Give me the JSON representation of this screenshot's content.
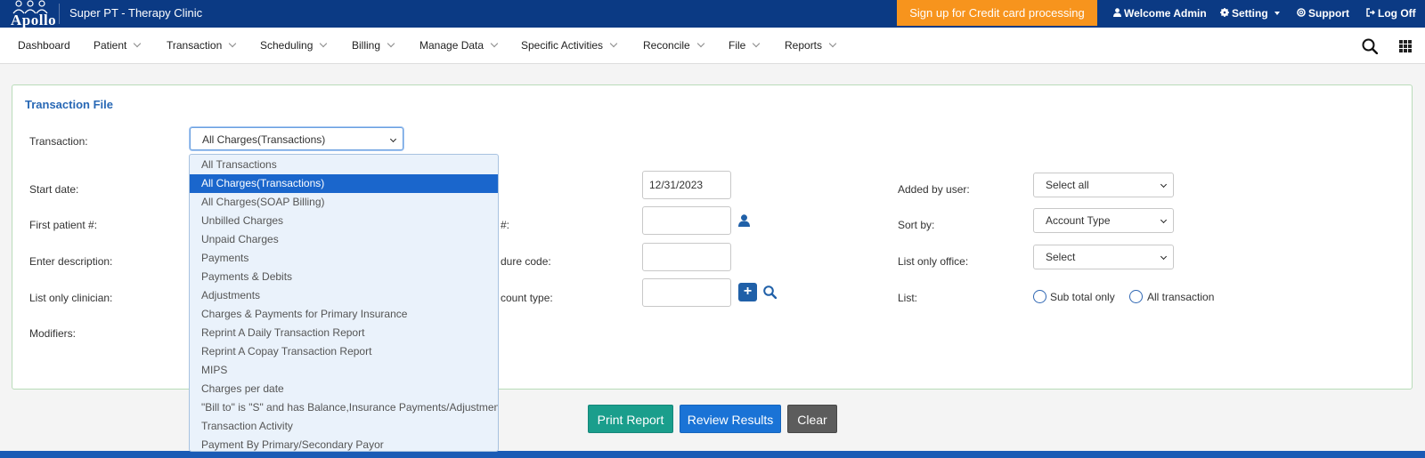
{
  "header": {
    "logo_text": "Apollo",
    "clinic_name": "Super PT - Therapy Clinic",
    "signup_label": "Sign up for Credit card processing",
    "welcome_label": "Welcome Admin",
    "setting_label": "Setting",
    "support_label": "Support",
    "logoff_label": "Log Off"
  },
  "nav": {
    "items": [
      "Dashboard",
      "Patient",
      "Transaction",
      "Scheduling",
      "Billing",
      "Manage Data",
      "Specific Activities",
      "Reconcile",
      "File",
      "Reports"
    ]
  },
  "form": {
    "title": "Transaction File",
    "transaction_label": "Transaction:",
    "transaction_value": "All Charges(Transactions)",
    "start_date_label": "Start date:",
    "end_date_value": "12/31/2023",
    "first_patient_label": "First patient #:",
    "last_patient_label_partial": "#:",
    "enter_description_label": "Enter description:",
    "procedure_code_label_partial": "dure code:",
    "list_only_clinician_label": "List only clinician:",
    "account_type_label_partial": "count type:",
    "modifiers_label": "Modifiers:",
    "added_by_user_label": "Added by user:",
    "added_by_user_value": "Select all",
    "sort_by_label": "Sort by:",
    "sort_by_value": "Account Type",
    "list_only_office_label": "List only office:",
    "list_only_office_value": "Select",
    "list_label": "List:",
    "radio_subtotal_label": "Sub total only",
    "radio_all_label": "All transaction"
  },
  "dropdown": {
    "options": [
      "All Transactions",
      "All Charges(Transactions)",
      "All Charges(SOAP Billing)",
      "Unbilled Charges",
      "Unpaid Charges",
      "Payments",
      "Payments & Debits",
      "Adjustments",
      "Charges & Payments for Primary Insurance",
      "Reprint A Daily Transaction Report",
      "Reprint A Copay Transaction Report",
      "MIPS",
      "Charges per date",
      "\"Bill to\" is \"S\" and has Balance,Insurance Payments/Adjustments",
      "Transaction Activity",
      "Payment By Primary/Secondary Payor"
    ],
    "selected_index": 1
  },
  "buttons": {
    "print_label": "Print Report",
    "review_label": "Review Results",
    "clear_label": "Clear"
  },
  "colors": {
    "header_bg": "#0b3a84",
    "signup_bg": "#f7941d",
    "accent_blue": "#1a66cc",
    "print_green": "#1a9e8c",
    "clear_gray": "#5c5c5c"
  }
}
